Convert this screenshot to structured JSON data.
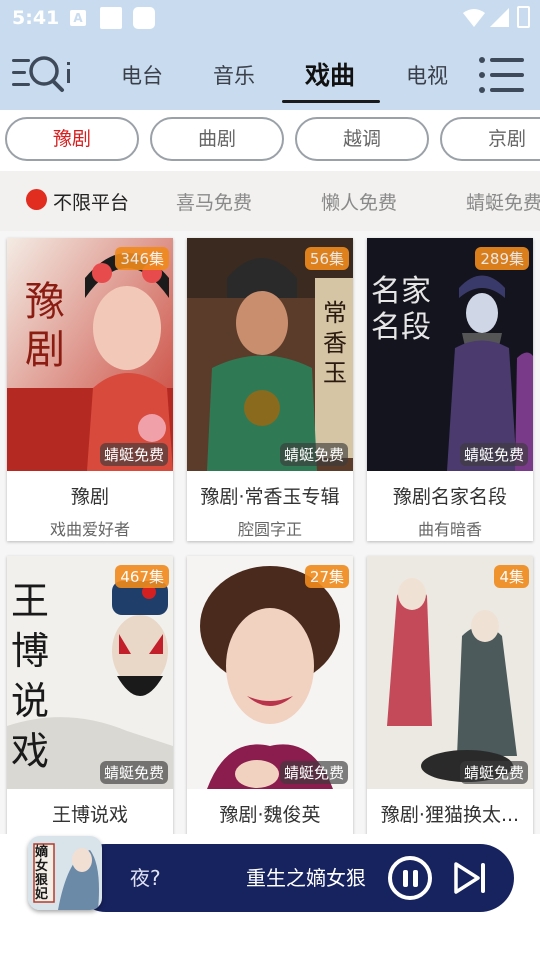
{
  "status_bar": {
    "time": "5:41",
    "notif_letter": "A"
  },
  "header": {
    "tabs": [
      {
        "label": "电台",
        "active": false
      },
      {
        "label": "音乐",
        "active": false
      },
      {
        "label": "戏曲",
        "active": true
      },
      {
        "label": "电视",
        "active": false
      }
    ]
  },
  "genres": [
    {
      "label": "豫剧",
      "active": true
    },
    {
      "label": "曲剧",
      "active": false
    },
    {
      "label": "越调",
      "active": false
    },
    {
      "label": "京剧",
      "active": false
    }
  ],
  "platforms": [
    {
      "label": "不限平台",
      "active": true
    },
    {
      "label": "喜马免费",
      "active": false
    },
    {
      "label": "懒人免费",
      "active": false
    },
    {
      "label": "蜻蜓免费",
      "active": false
    }
  ],
  "cards": [
    {
      "title": "豫剧",
      "subtitle": "戏曲爱好者",
      "count": "346集",
      "badge": "蜻蜓免费",
      "cover_text": "豫剧"
    },
    {
      "title": "豫剧·常香玉专辑",
      "subtitle": "腔圆字正",
      "count": "56集",
      "badge": "蜻蜓免费",
      "cover_text": "常香玉"
    },
    {
      "title": "豫剧名家名段",
      "subtitle": "曲有暗香",
      "count": "289集",
      "badge": "蜻蜓免费",
      "cover_text": "名家名段"
    },
    {
      "title": "王博说戏",
      "subtitle": "",
      "count": "467集",
      "badge": "蜻蜓免费",
      "cover_text": "王博说戏"
    },
    {
      "title": "豫剧·魏俊英",
      "subtitle": "",
      "count": "27集",
      "badge": "蜻蜓免费",
      "cover_text": ""
    },
    {
      "title": "豫剧·狸猫换太...",
      "subtitle": "",
      "count": "4集",
      "badge": "蜻蜓免费",
      "cover_text": ""
    }
  ],
  "player": {
    "prev_text_fragment": "夜?",
    "now_playing": "重生之嫡女狠妃",
    "cover_text": "嫡女狠妃",
    "state": "playing"
  },
  "colors": {
    "header_bg": "#c9dcef",
    "active_genre": "#d81e1e",
    "count_badge": "#f08a1c",
    "player_bg": "#17235f",
    "platform_dot": "#e12d1f"
  }
}
